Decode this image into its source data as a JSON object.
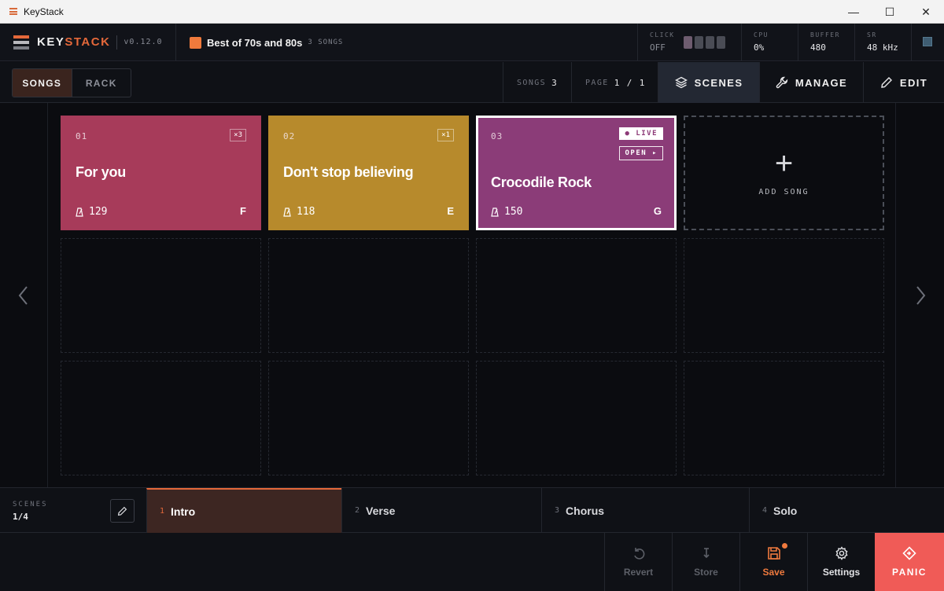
{
  "window": {
    "title": "KeyStack",
    "minimize": "—",
    "maximize": "☐",
    "close": "✕"
  },
  "header": {
    "brand_part1": "KEY",
    "brand_part2": "STACK",
    "version": "v0.12.0",
    "setlist_name": "Best of 70s and 80s",
    "setlist_count": "3 SONGS",
    "setlist_color": "#f07a3c",
    "click": {
      "label": "CLICK",
      "value": "OFF"
    },
    "cpu": {
      "label": "CPU",
      "value": "0%"
    },
    "buffer": {
      "label": "BUFFER",
      "value": "480"
    },
    "sr": {
      "label": "SR",
      "value": "48 kHz"
    }
  },
  "toolbar": {
    "mode_songs": "SONGS",
    "mode_rack": "RACK",
    "songs_label": "SONGS",
    "songs_value": "3",
    "page_label": "PAGE",
    "page_value": "1 / 1",
    "scenes_label": "SCENES",
    "manage_label": "MANAGE",
    "edit_label": "EDIT"
  },
  "songs": [
    {
      "num": "01",
      "name": "For you",
      "bpm": "129",
      "key": "F",
      "count": "×3",
      "color": "#a73b5a"
    },
    {
      "num": "02",
      "name": "Don't stop believing",
      "bpm": "118",
      "key": "E",
      "count": "×1",
      "color": "#b78a2c"
    },
    {
      "num": "03",
      "name": "Crocodile Rock",
      "bpm": "150",
      "key": "G",
      "live": "● LIVE",
      "open": "OPEN ▸",
      "color": "#8b3c78"
    }
  ],
  "add_song_label": "ADD SONG",
  "scenes": {
    "label": "SCENES",
    "value": "1/4",
    "tabs": [
      {
        "n": "1",
        "name": "Intro"
      },
      {
        "n": "2",
        "name": "Verse"
      },
      {
        "n": "3",
        "name": "Chorus"
      },
      {
        "n": "4",
        "name": "Solo"
      }
    ]
  },
  "footer": {
    "revert": "Revert",
    "store": "Store",
    "save": "Save",
    "settings": "Settings",
    "panic": "PANIC"
  }
}
